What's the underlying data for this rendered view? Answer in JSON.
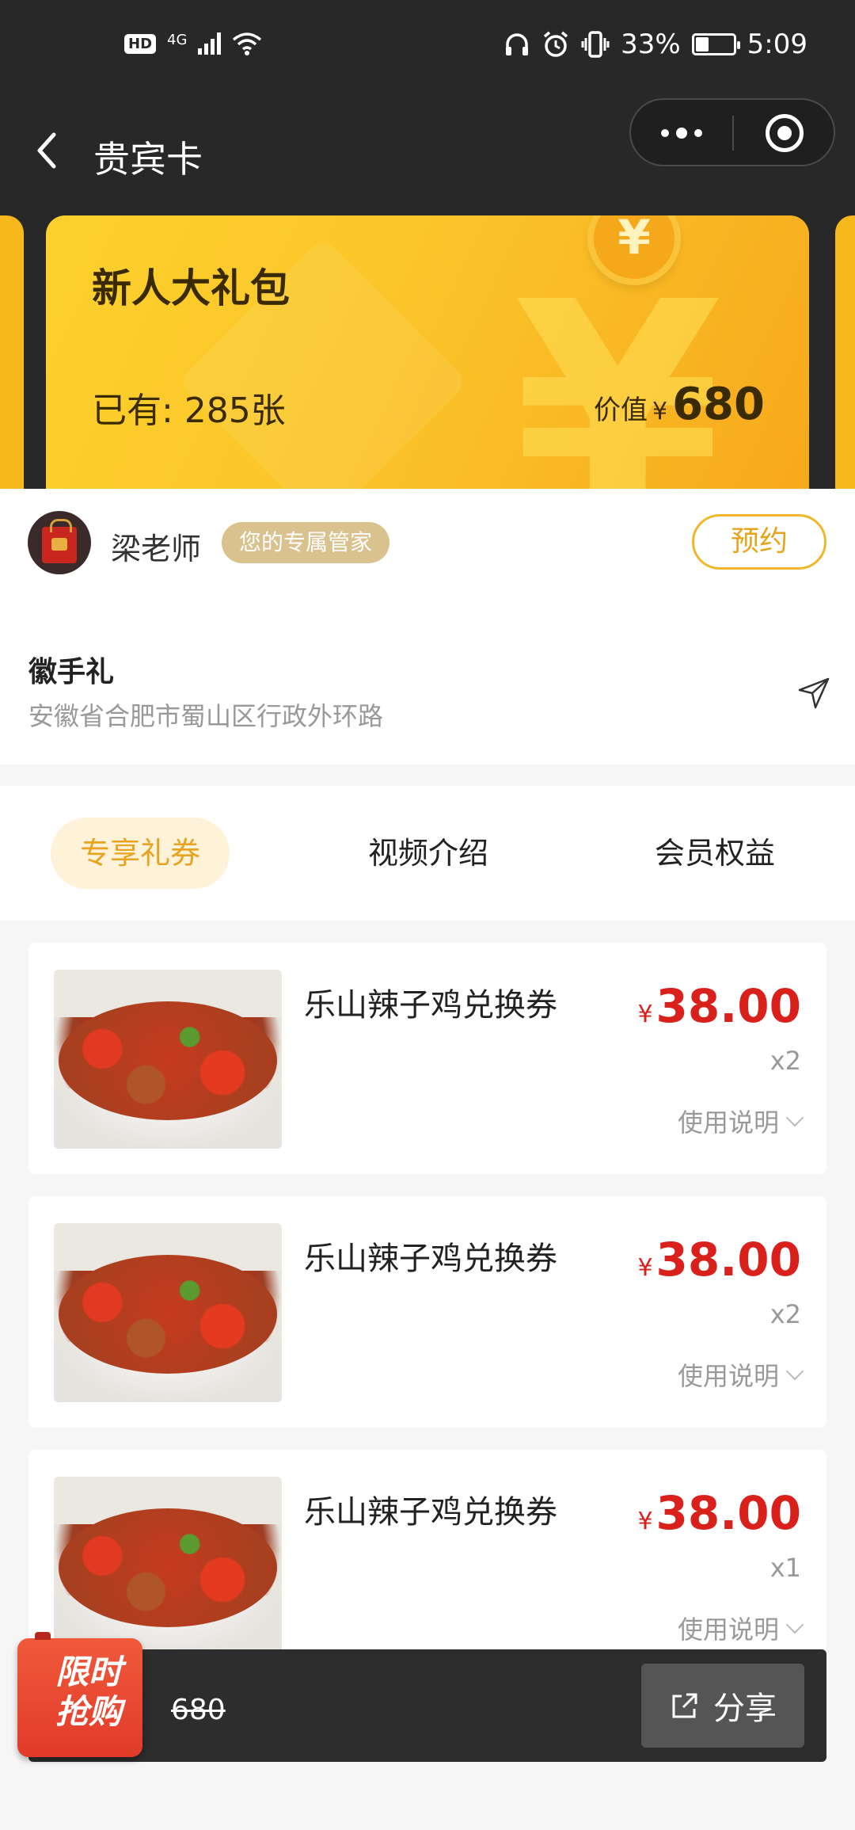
{
  "status_bar": {
    "hd": "HD",
    "network": "4G",
    "battery_text": "33%",
    "battery_level": 0.33,
    "time": "5:09"
  },
  "nav": {
    "title": "贵宾卡"
  },
  "card": {
    "title": "新人大礼包",
    "count_text": "已有: 285张",
    "value_label": "价值",
    "currency": "¥",
    "value": "680",
    "coin_symbol": "¥",
    "bg_symbol": "¥"
  },
  "manager": {
    "name": "梁老师",
    "badge": "您的专属管家",
    "reserve_label": "预约"
  },
  "shop": {
    "name": "徽手礼",
    "address": "安徽省合肥市蜀山区行政外环路"
  },
  "tabs": [
    {
      "label": "专享礼券",
      "active": true
    },
    {
      "label": "视频介绍",
      "active": false
    },
    {
      "label": "会员权益",
      "active": false
    }
  ],
  "coupons": [
    {
      "name": "乐山辣子鸡兑换券",
      "currency": "¥",
      "price": "38.00",
      "qty": "x2",
      "usage_label": "使用说明"
    },
    {
      "name": "乐山辣子鸡兑换券",
      "currency": "¥",
      "price": "38.00",
      "qty": "x2",
      "usage_label": "使用说明"
    },
    {
      "name": "乐山辣子鸡兑换券",
      "currency": "¥",
      "price": "38.00",
      "qty": "x1",
      "usage_label": "使用说明"
    }
  ],
  "bottom_bar": {
    "flash_line1": "限时",
    "flash_line2": "抢购",
    "old_price": "680",
    "share_label": "分享"
  },
  "colors": {
    "accent": "#f0b72a",
    "price_red": "#d9201a",
    "dark_bg": "#282828"
  }
}
